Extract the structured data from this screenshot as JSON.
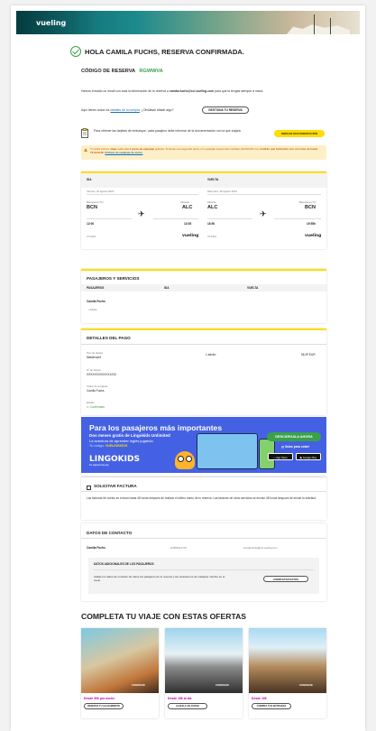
{
  "brand": {
    "logo": "vueling"
  },
  "header": {
    "title": "HOLA CAMILA FUCHS, RESERVA CONFIRMADA.",
    "code_label": "CÓDIGO DE RESERVA",
    "code_value": "RGWWVA",
    "email_intro": "Hemos enviado un email con toda la información de tu reserva a",
    "email": "camila.fuchs@cci.vueling.com",
    "email_outro": "para que la tengas siempre a mano.",
    "help_prefix": "Aquí tienes todos los",
    "help_link": "detalles de tu compra",
    "help_suffix": ". ¿Olvidaste añadir algo?",
    "manage_button": "GESTIONA TU RESERVA",
    "boarding_text": "Para obtener las tarjetas de embarque, cada pasajero debe informar de la documentación con la que viajará.",
    "boarding_button": "INDICAR DOCUMENTACIÓN"
  },
  "warning": {
    "text_a": "Tu tarifa incluye",
    "text_b": "viajar solo con 1 pieza de equipaje",
    "text_c": "gratuita. Si llevas una segunda pieza o tu equipaje supera las medidas (40x20x30 cm),",
    "text_d": "tendrás que facturarlo con un coste de hasta 75,00 EUR.",
    "link": "Política de equipaje de mano."
  },
  "flights": {
    "outbound": {
      "label": "IDA",
      "date": "Viernes, 24 agosto 2024",
      "from_city": "Barcelona (T1)",
      "from_code": "BCN",
      "dep_time": "12:00",
      "to_city": "Alicante",
      "to_code": "ALC",
      "arr_time": "13:05",
      "flight_no": "VY1324",
      "carrier": "vueling"
    },
    "return": {
      "label": "VUELTA",
      "date": "Miércoles, 28 agosto 2024",
      "from_city": "Alicante",
      "from_code": "ALC",
      "dep_time": "18:50",
      "to_city": "Barcelona (T1)",
      "to_code": "BCN",
      "arr_time": "19:55h",
      "flight_no": "VY1321",
      "carrier": "vueling"
    }
  },
  "passengers": {
    "title": "PASAJEROS Y SERVICIOS",
    "columns": [
      "PASAJEROS",
      "IDA",
      "VUELTA"
    ],
    "name": "Camila Fuchs",
    "type": "Adulto"
  },
  "payment": {
    "title": "DETALLES DEL PAGO",
    "method_label": "Tipo de tarjeta",
    "method": "Mastercard",
    "passengers_count": "1 adulto",
    "amount": "56,39 EUR",
    "card_label": "Nº de tarjeta",
    "card": "XXXXXXXXXXXX1234",
    "holder_label": "Titular de la tarjeta",
    "holder": "Camila Fuchs",
    "status_label": "Estado",
    "status": "Confirmado"
  },
  "promo": {
    "headline": "Para los pasajeros más importantes",
    "line1": "Dos meses gratis de Lingokids Unlimited",
    "line2": "La aventura de aprender inglés jugando",
    "code_label": "Tu código:",
    "code": "VUELINGKIDS",
    "brand": "LINGOKIDS",
    "sub": "the playlearning app",
    "download": "DESCÁRGALA AHORA",
    "vote": "¡y listos para volar!",
    "appstore": "App Store",
    "googleplay": "Google Play"
  },
  "invoice": {
    "title": "SOLICITAR FACTURA",
    "text": "Las facturas de vuelos se envían hasta 48 horas después de realizar el último tramo de tu reserva. Las facturas de otros servicios se envían 48 horas después de enviar la solicitud."
  },
  "contact": {
    "title": "DATOS DE CONTACTO",
    "name": "Camila Fuchs",
    "phone": "+34666412770",
    "email": "camila.fuchs@cci.vueling.com",
    "extra_title": "DATOS ADICIONALES DE LOS PASAJEROS",
    "extra_text": "Añade los datos de contacto de todos los pasajeros de tu reserva y les avisaremos de cualquier cambio en el vuelo.",
    "extra_button": "COMPLETAR DATOS"
  },
  "offers": {
    "title": "COMPLETA TU VIAJE CON ESTAS OFERTAS",
    "items": [
      {
        "caption": "Desde 30€ por noche",
        "button": "RESERVA TU ALOJAMIENTO",
        "watermark": "CONSIGUE"
      },
      {
        "caption": "Desde 15€ al día",
        "button": "ALQUILA UN COCHE",
        "watermark": "CONSIGUE"
      },
      {
        "caption": "Desde 10€",
        "button": "COMPRA TUS ENTRADAS",
        "watermark": "CONSIGUE"
      }
    ]
  },
  "colors": {
    "accent": "#ffdd00",
    "success": "#3aa14a",
    "promo": "#4561e3",
    "offer_text": "#b5009e"
  },
  "icons": [
    "check-circle-icon",
    "document-icon",
    "warning-icon",
    "plane-icon",
    "checkbox-icon"
  ]
}
